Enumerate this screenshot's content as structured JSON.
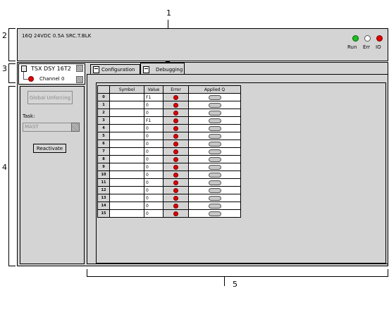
{
  "callouts": {
    "n1": "1",
    "n2": "2",
    "n3": "3",
    "n4": "4",
    "n5": "5"
  },
  "module": {
    "title": "16Q 24VDC 0.5A SRC.T.BLK",
    "leds": [
      {
        "label": "Run",
        "color": "#1fbf1f"
      },
      {
        "label": "Err",
        "color": "#ffffff"
      },
      {
        "label": "IO",
        "color": "#e00000"
      }
    ]
  },
  "tree": {
    "device": "TSX DSY 16T2",
    "channel": "Channel 0"
  },
  "left": {
    "global_unforcing": "Global  Unforcing",
    "task_label": "Task:",
    "task_value": "MAST",
    "reactivate": "Reactivate"
  },
  "tabs": {
    "configuration": "Configuration",
    "debugging": "Debugging"
  },
  "table": {
    "headers": [
      "Symbol",
      "Value",
      "Error",
      "Applied Q"
    ],
    "rows": [
      {
        "idx": "0",
        "value": "F1"
      },
      {
        "idx": "1",
        "value": "0"
      },
      {
        "idx": "2",
        "value": "0"
      },
      {
        "idx": "3",
        "value": "F1"
      },
      {
        "idx": "4",
        "value": "0"
      },
      {
        "idx": "5",
        "value": "0"
      },
      {
        "idx": "6",
        "value": "0"
      },
      {
        "idx": "7",
        "value": "0"
      },
      {
        "idx": "8",
        "value": "0"
      },
      {
        "idx": "9",
        "value": "0"
      },
      {
        "idx": "10",
        "value": "0"
      },
      {
        "idx": "11",
        "value": "0"
      },
      {
        "idx": "12",
        "value": "0"
      },
      {
        "idx": "13",
        "value": "0"
      },
      {
        "idx": "14",
        "value": "0"
      },
      {
        "idx": "15",
        "value": "0"
      }
    ]
  }
}
